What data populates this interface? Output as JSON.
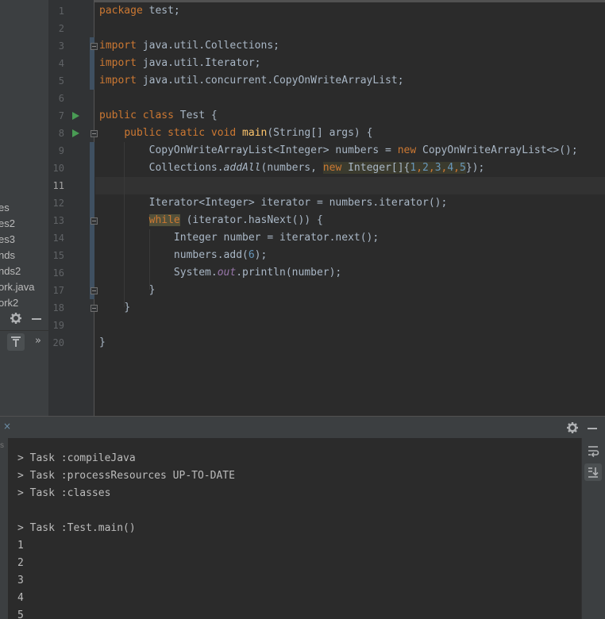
{
  "project_panel": {
    "items": [
      "es",
      "es2",
      "es3",
      "nds",
      "nds2",
      "ork.java",
      "ork2"
    ],
    "toolbar_icons": [
      "gear-icon",
      "minimize-icon",
      "scroll-from-source-icon",
      "more-icon"
    ],
    "more_glyph": "»"
  },
  "editor": {
    "line_numbers": [
      "1",
      "2",
      "3",
      "4",
      "5",
      "6",
      "7",
      "8",
      "9",
      "10",
      "11",
      "12",
      "13",
      "14",
      "15",
      "16",
      "17",
      "18",
      "19",
      "20"
    ],
    "current_line": "11",
    "run_markers_lines": [
      "7",
      "8"
    ],
    "code": {
      "l1": [
        "package",
        "test;"
      ],
      "l3": [
        "import",
        "java.util.Collections;"
      ],
      "l4": [
        "import",
        "java.util.Iterator;"
      ],
      "l5": [
        "import",
        "java.util.concurrent.CopyOnWriteArrayList;"
      ],
      "l7": [
        "public",
        "class",
        "Test {"
      ],
      "l8": [
        "public",
        "static",
        "void",
        "main",
        "(String[] args) {"
      ],
      "l9": [
        "CopyOnWriteArrayList<Integer> numbers = ",
        "new",
        " CopyOnWriteArrayList<>();"
      ],
      "l10": [
        "Collections.",
        "addAll",
        "(numbers, ",
        "new",
        " Integer[]{",
        "1",
        ",",
        "2",
        ",",
        "3",
        ",",
        "4",
        ",",
        "5",
        "});"
      ],
      "l12": [
        "Iterator<Integer> iterator = numbers.iterator();"
      ],
      "l13": [
        "while",
        " (iterator.hasNext()) {"
      ],
      "l14": [
        "Integer number = iterator.next();"
      ],
      "l15": [
        "numbers.add(",
        "6",
        ");"
      ],
      "l16": [
        "System.",
        "out",
        ".println(number);"
      ],
      "l17": [
        "}"
      ],
      "l18": [
        "}"
      ],
      "l20": [
        "}"
      ]
    }
  },
  "run_panel": {
    "tab_close_glyph": "×",
    "side_fragment": "s",
    "header_icons": [
      "gear-icon",
      "minimize-icon"
    ],
    "side_icons": [
      "soft-wrap-icon",
      "scroll-to-end-icon"
    ],
    "output": [
      "> Task :compileJava",
      "> Task :processResources UP-TO-DATE",
      "> Task :classes",
      "",
      "> Task :Test.main()",
      "1",
      "2",
      "3",
      "4",
      "5"
    ]
  },
  "colors": {
    "keyword": "#cc7832",
    "method_decl": "#ffc66d",
    "number": "#6897bb",
    "static_field": "#9876aa",
    "text": "#a9b7c6",
    "run_marker": "#499c54"
  }
}
